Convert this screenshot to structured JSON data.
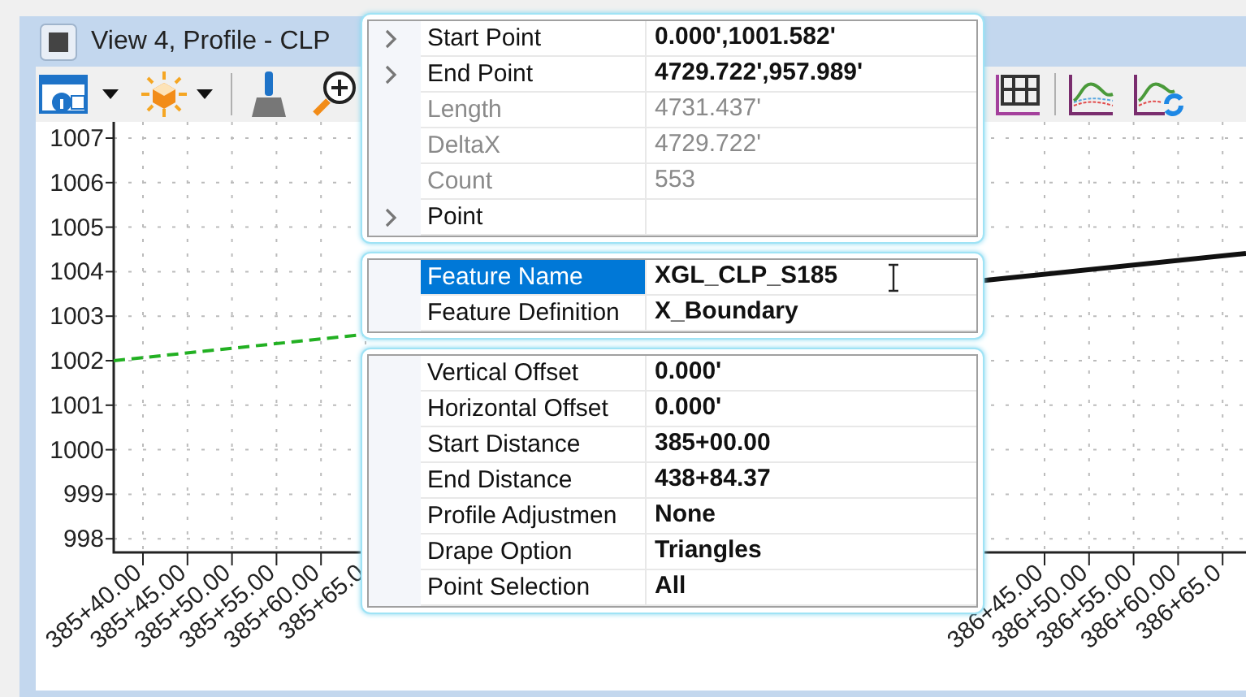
{
  "window": {
    "title": "View 4, Profile - CLP"
  },
  "plot": {
    "y_axis_labels": [
      "1007",
      "1006",
      "1005",
      "1004",
      "1003",
      "1002",
      "1001",
      "1000",
      "999",
      "998"
    ],
    "x_axis_labels_left": [
      "385+40.00",
      "385+45.00",
      "385+50.00",
      "385+55.00",
      "385+60.00",
      "385+65.0"
    ],
    "x_axis_labels_right": [
      "386+45.00",
      "386+50.00",
      "386+55.00",
      "386+60.00",
      "386+65.0"
    ]
  },
  "property_sections": [
    {
      "rows": [
        {
          "label": "Start Point",
          "value": "0.000',1001.582'",
          "expandable": true,
          "dimmed": false,
          "selected": false
        },
        {
          "label": "End Point",
          "value": "4729.722',957.989'",
          "expandable": true,
          "dimmed": false,
          "selected": false
        },
        {
          "label": "Length",
          "value": "4731.437'",
          "expandable": false,
          "dimmed": true,
          "selected": false
        },
        {
          "label": "DeltaX",
          "value": "4729.722'",
          "expandable": false,
          "dimmed": true,
          "selected": false
        },
        {
          "label": "Count",
          "value": "553",
          "expandable": false,
          "dimmed": true,
          "selected": false
        },
        {
          "label": "Point",
          "value": "",
          "expandable": true,
          "dimmed": false,
          "selected": false
        }
      ]
    },
    {
      "rows": [
        {
          "label": "Feature Name",
          "value": "XGL_CLP_S185",
          "expandable": false,
          "dimmed": false,
          "selected": true
        },
        {
          "label": "Feature Definition",
          "value": "X_Boundary",
          "expandable": false,
          "dimmed": false,
          "selected": false
        }
      ]
    },
    {
      "rows": [
        {
          "label": "Vertical Offset",
          "value": "0.000'",
          "expandable": false,
          "dimmed": false,
          "selected": false
        },
        {
          "label": "Horizontal Offset",
          "value": "0.000'",
          "expandable": false,
          "dimmed": false,
          "selected": false
        },
        {
          "label": "Start Distance",
          "value": "385+00.00",
          "expandable": false,
          "dimmed": false,
          "selected": false
        },
        {
          "label": "End Distance",
          "value": "438+84.37",
          "expandable": false,
          "dimmed": false,
          "selected": false
        },
        {
          "label": "Profile Adjustmen",
          "value": "None",
          "expandable": false,
          "dimmed": false,
          "selected": false
        },
        {
          "label": "Drape Option",
          "value": "Triangles",
          "expandable": false,
          "dimmed": false,
          "selected": false
        },
        {
          "label": "Point Selection",
          "value": "All",
          "expandable": false,
          "dimmed": false,
          "selected": false
        }
      ]
    }
  ]
}
